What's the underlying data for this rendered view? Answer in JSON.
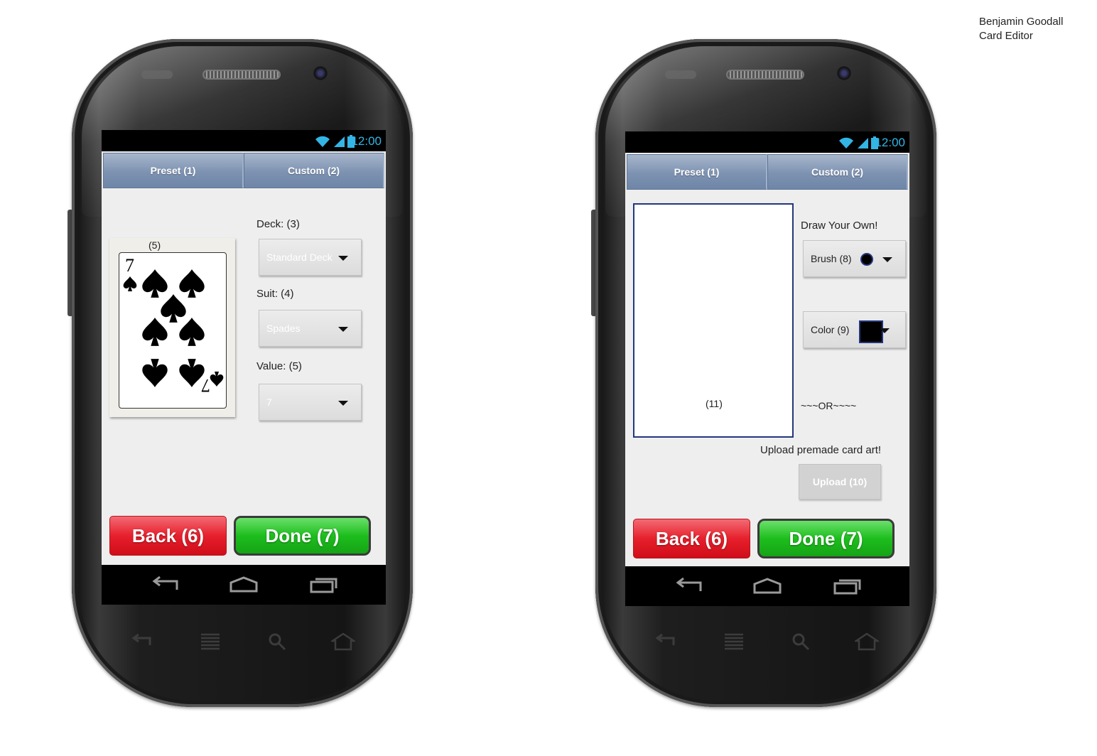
{
  "header": {
    "author": "Benjamin Goodall",
    "subtitle": "Card Editor"
  },
  "status_bar": {
    "time": "12:00"
  },
  "tabs": {
    "preset": "Preset (1)",
    "custom": "Custom (2)"
  },
  "preset_screen": {
    "card_label": "(5)",
    "card": {
      "rank": "7",
      "suit": "spades"
    },
    "deck_label": "Deck: (3)",
    "deck_value": "Standard Deck",
    "suit_label": "Suit: (4)",
    "suit_value": "Spades",
    "value_label": "Value: (5)",
    "value_value": "7"
  },
  "custom_screen": {
    "canvas_label": "(11)",
    "draw_heading": "Draw Your Own!",
    "brush_label": "Brush (8)",
    "color_label": "Color (9)",
    "selected_color": "#000000",
    "or_divider": "~~~OR~~~~",
    "upload_heading": "Upload premade card art!",
    "upload_button": "Upload (10)"
  },
  "actions": {
    "back": "Back (6)",
    "done": "Done (7)"
  },
  "colors": {
    "accent": "#33b5e5",
    "back": "#e6202c",
    "done": "#1dbe1d",
    "tab": "#7d92b1",
    "canvas_border": "#24367d"
  }
}
